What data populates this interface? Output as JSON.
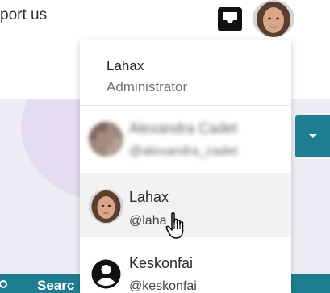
{
  "header": {
    "support_text": "port us",
    "inbox_icon": "inbox-icon"
  },
  "background": {
    "search_label": "Searc"
  },
  "dropdown": {
    "current_user": {
      "name": "Lahax",
      "role": "Administrator"
    },
    "accounts": [
      {
        "name": "Alexandra Cadet",
        "handle": "@alexandra_cadet",
        "blurred": true
      },
      {
        "name": "Lahax",
        "handle": "@laha",
        "blurred": false,
        "hovered": true
      },
      {
        "name": "Keskonfai",
        "handle": "@keskonfai",
        "blurred": false
      }
    ]
  },
  "colors": {
    "accent": "#1f7d92",
    "page_bg": "#eeecf4",
    "blob": "#e4ddf1"
  }
}
